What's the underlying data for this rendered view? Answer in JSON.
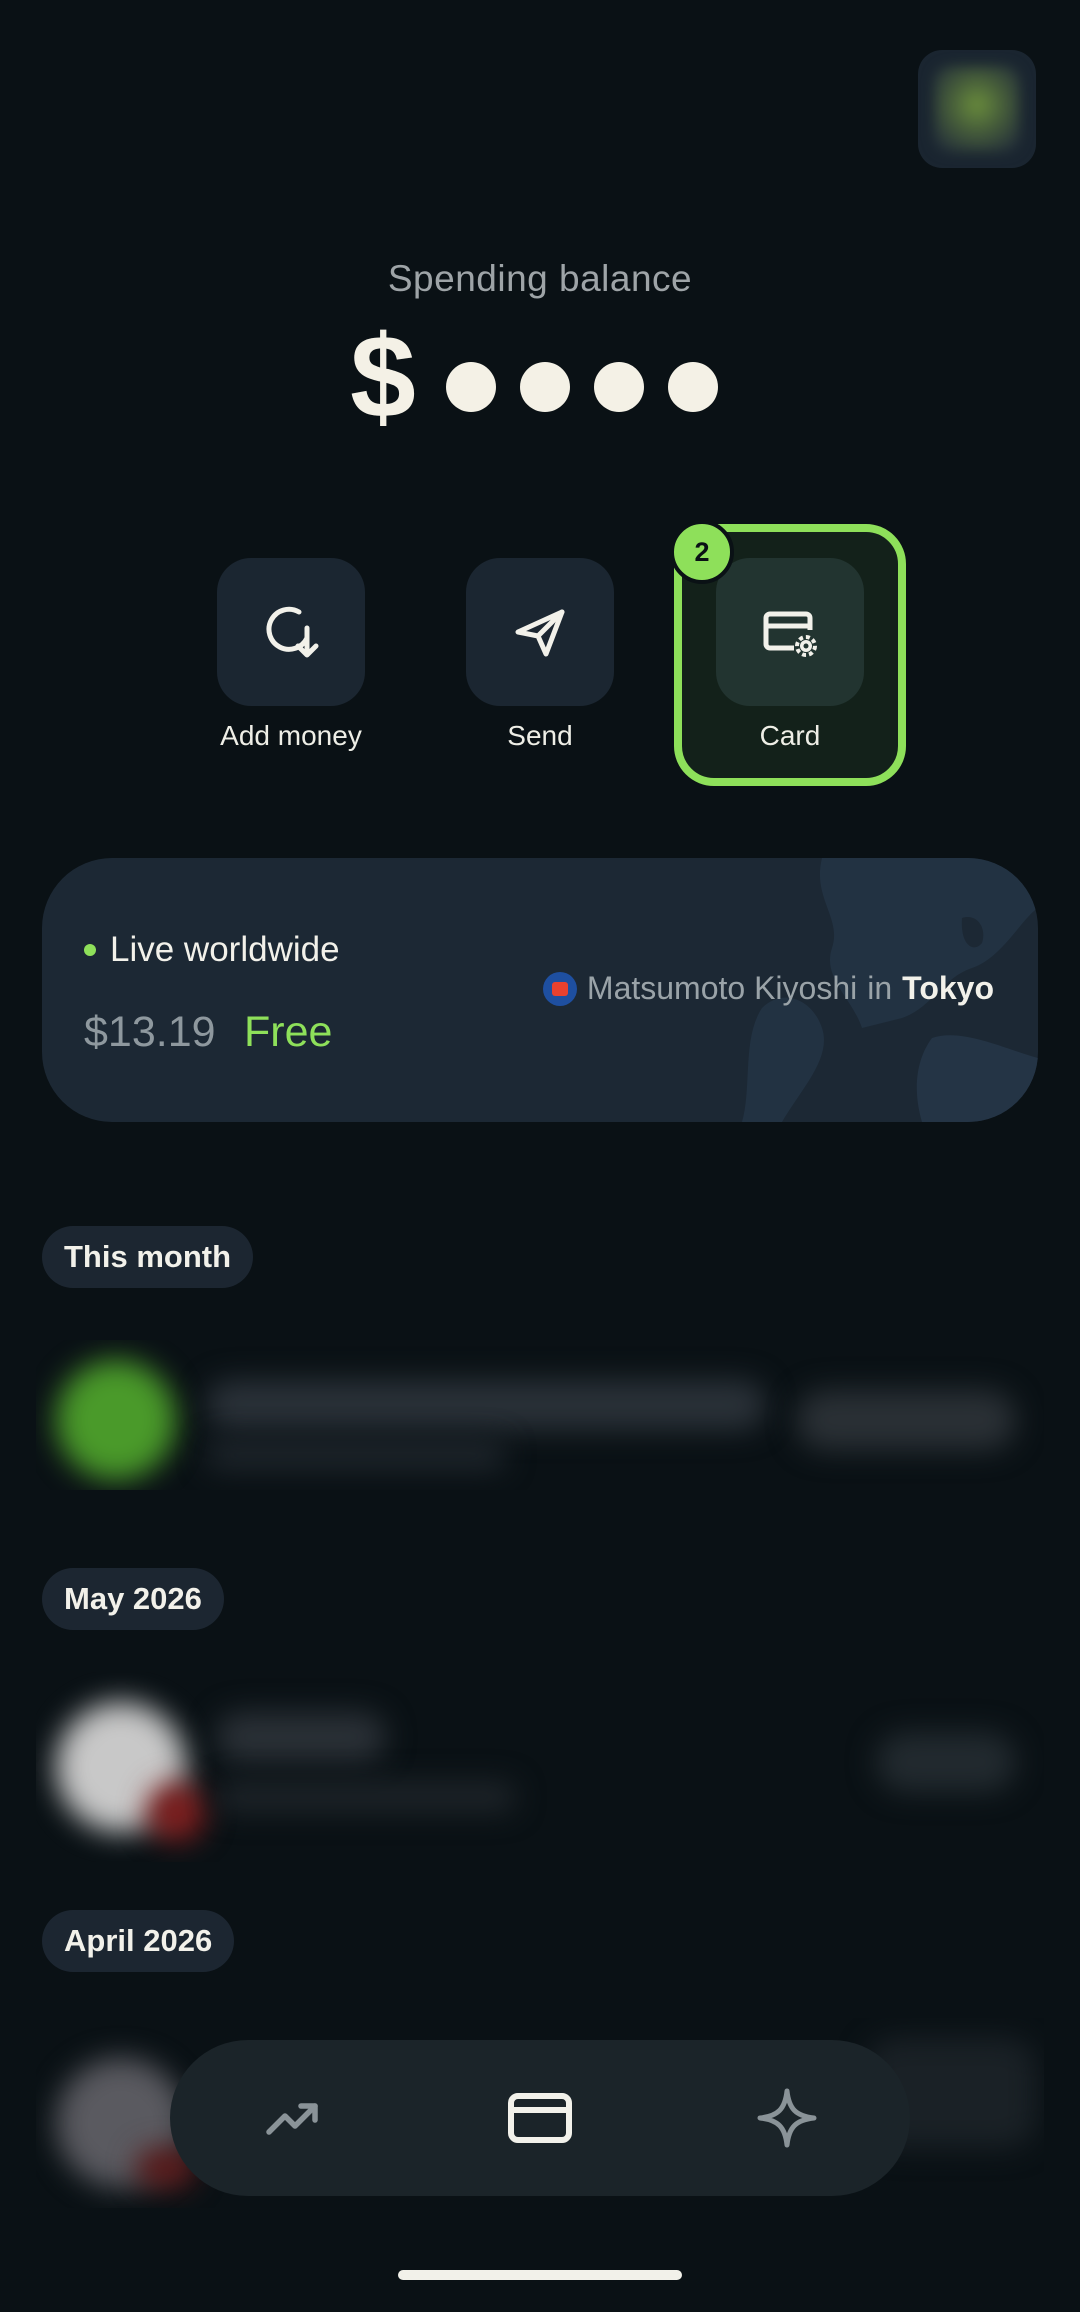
{
  "header": {
    "balance_label": "Spending balance",
    "currency_symbol": "$",
    "masked_digits": 4
  },
  "actions": [
    {
      "label": "Add money",
      "icon": "add-money-icon"
    },
    {
      "label": "Send",
      "icon": "send-icon"
    },
    {
      "label": "Card",
      "icon": "card-settings-icon",
      "badge": "2",
      "highlighted": true
    }
  ],
  "live_card": {
    "title": "Live worldwide",
    "amount": "$13.19",
    "fee": "Free",
    "merchant": "Matsumoto Kiyoshi",
    "connector": "in",
    "city": "Tokyo"
  },
  "sections": [
    {
      "label": "This month"
    },
    {
      "label": "May 2026"
    },
    {
      "label": "April 2026"
    }
  ],
  "bottom_nav": [
    {
      "icon": "trending-icon"
    },
    {
      "icon": "card-icon",
      "active": true
    },
    {
      "icon": "sparkle-icon"
    }
  ],
  "colors": {
    "background": "#0a1115",
    "accent": "#8ee05a",
    "tile": "#1b2631"
  }
}
